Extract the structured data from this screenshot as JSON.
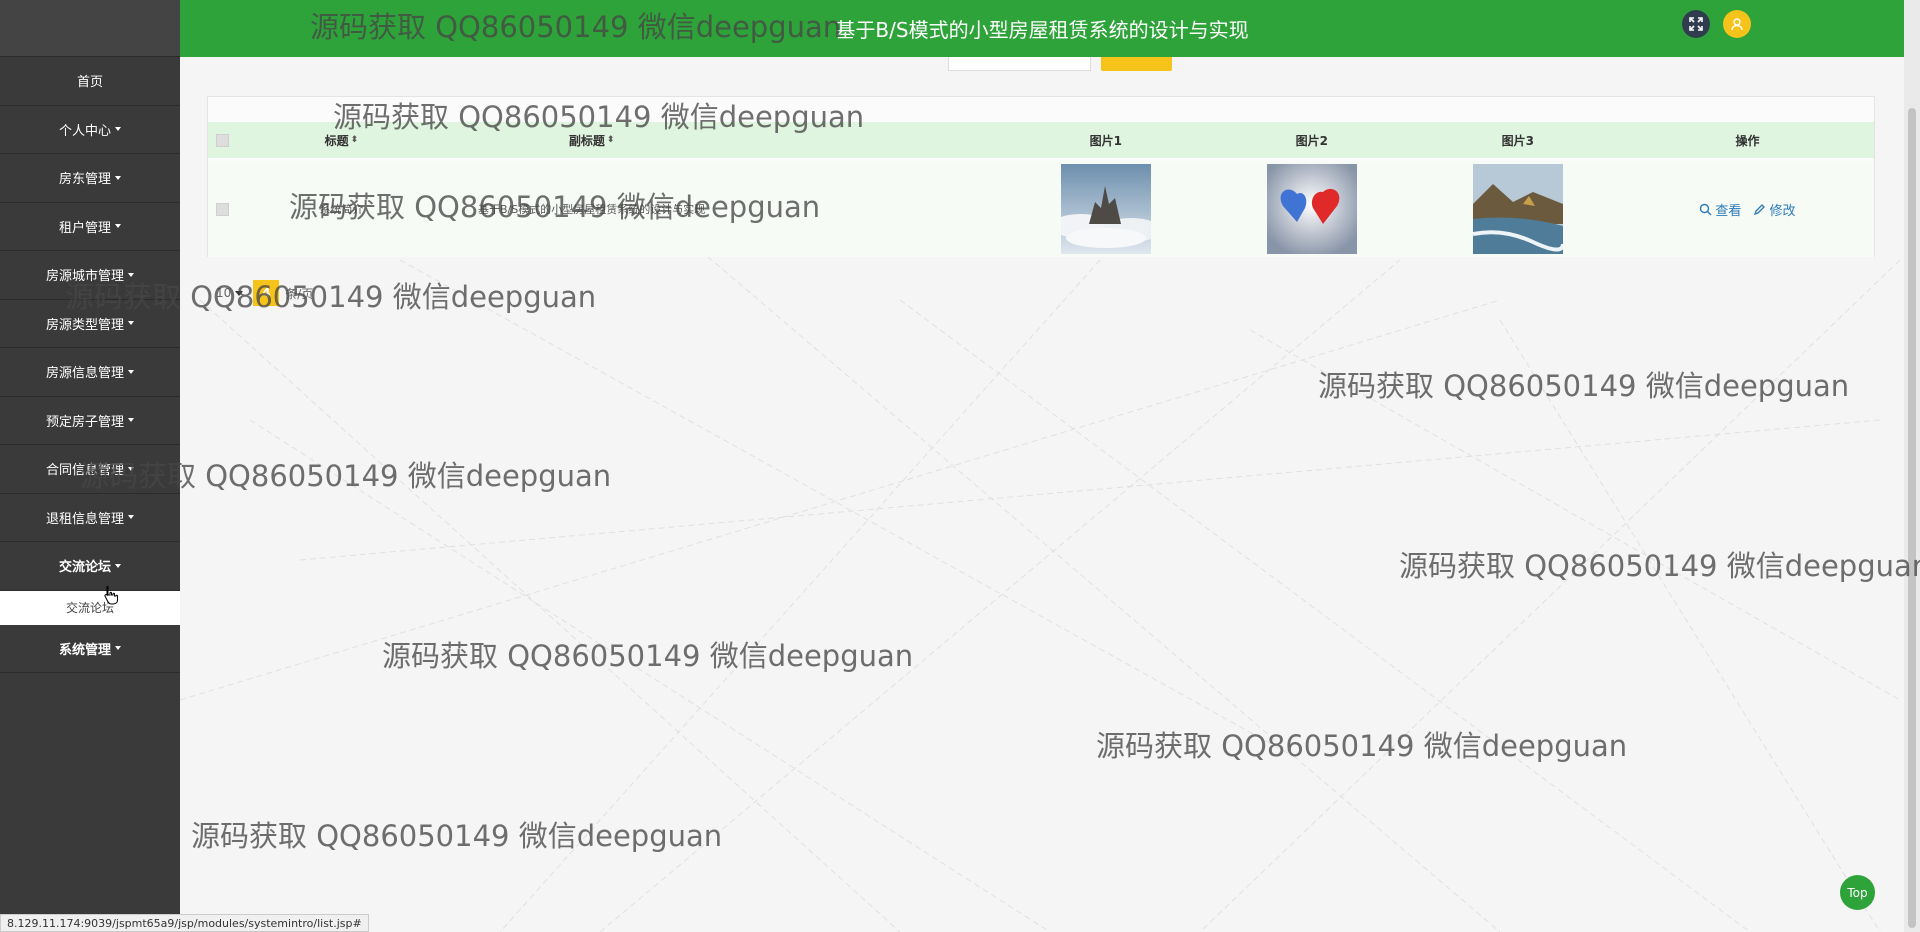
{
  "header": {
    "title": "基于B/S模式的小型房屋租赁系统的设计与实现",
    "fullscreen_icon": "fullscreen-icon",
    "user_icon": "user-icon"
  },
  "sidebar": {
    "items": [
      {
        "label": "首页",
        "caret": false
      },
      {
        "label": "个人中心",
        "caret": true
      },
      {
        "label": "房东管理",
        "caret": true
      },
      {
        "label": "租户管理",
        "caret": true
      },
      {
        "label": "房源城市管理",
        "caret": true
      },
      {
        "label": "房源类型管理",
        "caret": true
      },
      {
        "label": "房源信息管理",
        "caret": true
      },
      {
        "label": "预定房子管理",
        "caret": true
      },
      {
        "label": "合同信息管理",
        "caret": true
      },
      {
        "label": "退租信息管理",
        "caret": true
      },
      {
        "label": "交流论坛",
        "caret": true,
        "open": true
      },
      {
        "label": "系统管理",
        "caret": true
      }
    ],
    "submenu": {
      "label": "交流论坛"
    }
  },
  "table": {
    "columns": [
      "标题",
      "副标题",
      "图片1",
      "图片2",
      "图片3",
      "操作"
    ],
    "rows": [
      {
        "title": "系统简介",
        "subtitle": "基于B/S模式的小型房屋租赁系统的设计与实现",
        "images": [
          "castle-in-clouds-image",
          "two-hearts-image",
          "coastline-image"
        ],
        "actions": [
          "查看",
          "修改"
        ]
      }
    ]
  },
  "pager": {
    "current": "4",
    "size_label": "条/页"
  },
  "watermark_text": "源码获取 QQ86050149 微信deepguan",
  "status_url": "8.129.11.174:9039/jspmt65a9/jsp/modules/systemintro/list.jsp#",
  "top_button": "Top",
  "colors": {
    "header": "#2ea33a",
    "sidebar": "#3a3a3a",
    "accent": "#f5c31a",
    "table_header": "#dff5df",
    "link": "#2c7ab8"
  }
}
